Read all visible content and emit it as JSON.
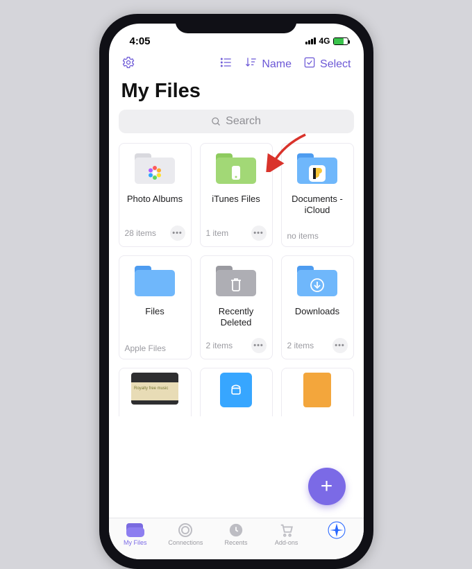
{
  "statusbar": {
    "time": "4:05",
    "network": "4G"
  },
  "toolbar": {
    "sort_label": "Name",
    "select_label": "Select"
  },
  "page_title": "My Files",
  "search": {
    "placeholder": "Search"
  },
  "tiles": [
    {
      "name": "Photo Albums",
      "subtitle": "28 items",
      "has_more": true
    },
    {
      "name": "iTunes Files",
      "subtitle": "1 item",
      "has_more": true
    },
    {
      "name": "Documents - iCloud",
      "subtitle": "no items",
      "has_more": false
    },
    {
      "name": "Files",
      "subtitle": "Apple Files",
      "has_more": false
    },
    {
      "name": "Recently Deleted",
      "subtitle": "2 items",
      "has_more": true
    },
    {
      "name": "Downloads",
      "subtitle": "2 items",
      "has_more": true
    }
  ],
  "tabs": [
    {
      "label": "My Files"
    },
    {
      "label": "Connections"
    },
    {
      "label": "Recents"
    },
    {
      "label": "Add-ons"
    },
    {
      "label": ""
    }
  ],
  "fab_label": "+",
  "colors": {
    "accent": "#7b6ae6"
  }
}
